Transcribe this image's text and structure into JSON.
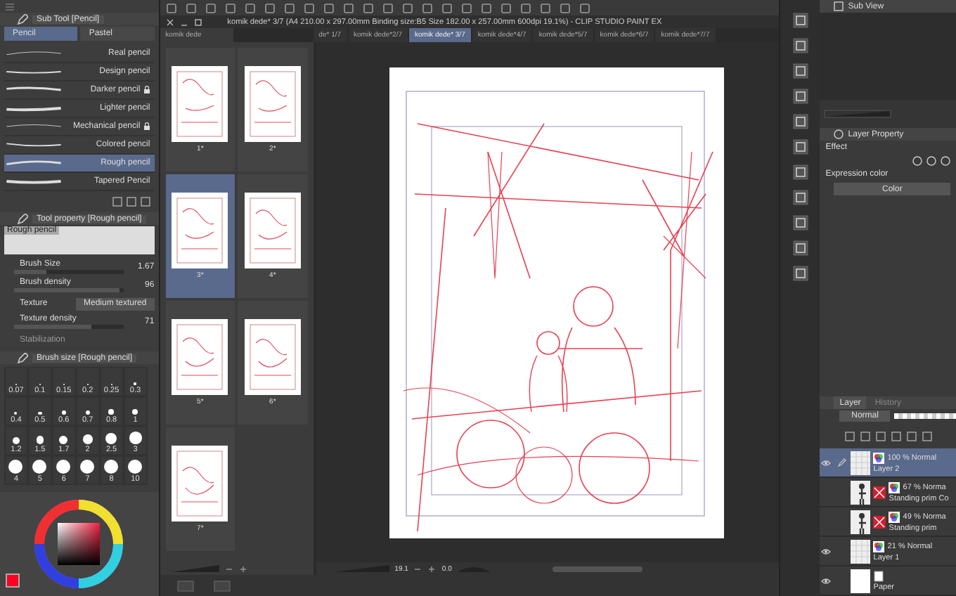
{
  "title_bar": {
    "title": "komik dede* 3/7 (A4 210.00 x 297.00mm Binding size:B5 Size 182.00 x 257.00mm 600dpi 19.1%) - CLIP STUDIO PAINT EX"
  },
  "page_manager_tab": {
    "label": "komik dede"
  },
  "doc_tabs": [
    {
      "label": "de* 1/7",
      "selected": false
    },
    {
      "label": "komik dede*2/7",
      "selected": false
    },
    {
      "label": "komik dede* 3/7",
      "selected": true
    },
    {
      "label": "komik dede*4/7",
      "selected": false
    },
    {
      "label": "komik dede*5/7",
      "selected": false
    },
    {
      "label": "komik dede*6/7",
      "selected": false
    },
    {
      "label": "komik dede*7/7",
      "selected": false
    }
  ],
  "sub_tool": {
    "title": "Sub Tool [Pencil]",
    "groups": [
      {
        "label": "Pencil",
        "selected": true
      },
      {
        "label": "Pastel",
        "selected": false
      }
    ],
    "brushes": [
      {
        "name": "Real pencil",
        "locked": false,
        "selected": false
      },
      {
        "name": "Design pencil",
        "locked": false,
        "selected": false
      },
      {
        "name": "Darker pencil",
        "locked": true,
        "selected": false
      },
      {
        "name": "Lighter pencil",
        "locked": false,
        "selected": false
      },
      {
        "name": "Mechanical pencil",
        "locked": true,
        "selected": false
      },
      {
        "name": "Colored pencil",
        "locked": false,
        "selected": false
      },
      {
        "name": "Rough pencil",
        "locked": false,
        "selected": true
      },
      {
        "name": "Tapered Pencil",
        "locked": false,
        "selected": false
      }
    ]
  },
  "tool_property": {
    "title": "Tool property [Rough pencil]",
    "preset": "Rough pencil",
    "settings": [
      {
        "kind": "slider",
        "label": "Brush Size",
        "value": "1.67",
        "level": 0.3
      },
      {
        "kind": "slider",
        "label": "Brush density",
        "value": "96",
        "level": 0.96
      },
      {
        "kind": "select",
        "label": "Texture",
        "value": "Medium textured"
      },
      {
        "kind": "slider",
        "label": "Texture density",
        "value": "71",
        "level": 0.71
      }
    ],
    "next_label": "Stabilization"
  },
  "brush_size": {
    "title": "Brush size [Rough pencil]",
    "sizes": [
      "0.07",
      "0.1",
      "0.15",
      "0.2",
      "0.25",
      "0.3",
      "0.4",
      "0.5",
      "0.6",
      "0.7",
      "0.8",
      "1",
      "1.2",
      "1.5",
      "1.7",
      "2",
      "2.5",
      "3",
      "4",
      "5",
      "6",
      "7",
      "8",
      "10"
    ]
  },
  "pages": [
    {
      "label": "1*",
      "selected": false
    },
    {
      "label": "2*",
      "selected": false
    },
    {
      "label": "3*",
      "selected": true
    },
    {
      "label": "4*",
      "selected": false
    },
    {
      "label": "5*",
      "selected": false
    },
    {
      "label": "6*",
      "selected": false
    },
    {
      "label": "7*",
      "selected": false
    }
  ],
  "canvas_status": {
    "zoom": "19.1",
    "angle": "0.0"
  },
  "sub_view": {
    "title": "Sub View"
  },
  "layer_property": {
    "title": "Layer Property",
    "effect_label": "Effect",
    "expression_label": "Expression color",
    "expression_value": "Color"
  },
  "layer_panel": {
    "tabs": [
      {
        "label": "Layer",
        "selected": true
      },
      {
        "label": "History",
        "selected": false
      }
    ],
    "blend_mode": "Normal",
    "opacity": {
      "level": 1
    },
    "layers": [
      {
        "kind": "raster",
        "mode": "100 % Normal",
        "name": "Layer 2",
        "visible": true,
        "selected": true
      },
      {
        "kind": "material",
        "mode": "67 % Norma",
        "name": "Standing prim Co",
        "visible": false,
        "selected": false
      },
      {
        "kind": "material",
        "mode": "49 % Norma",
        "name": "Standing prim",
        "visible": false,
        "selected": false
      },
      {
        "kind": "raster",
        "mode": "21 % Normal",
        "name": "Layer 1",
        "visible": true,
        "selected": false
      },
      {
        "kind": "paper",
        "name": "Paper",
        "visible": true,
        "selected": false
      }
    ]
  }
}
